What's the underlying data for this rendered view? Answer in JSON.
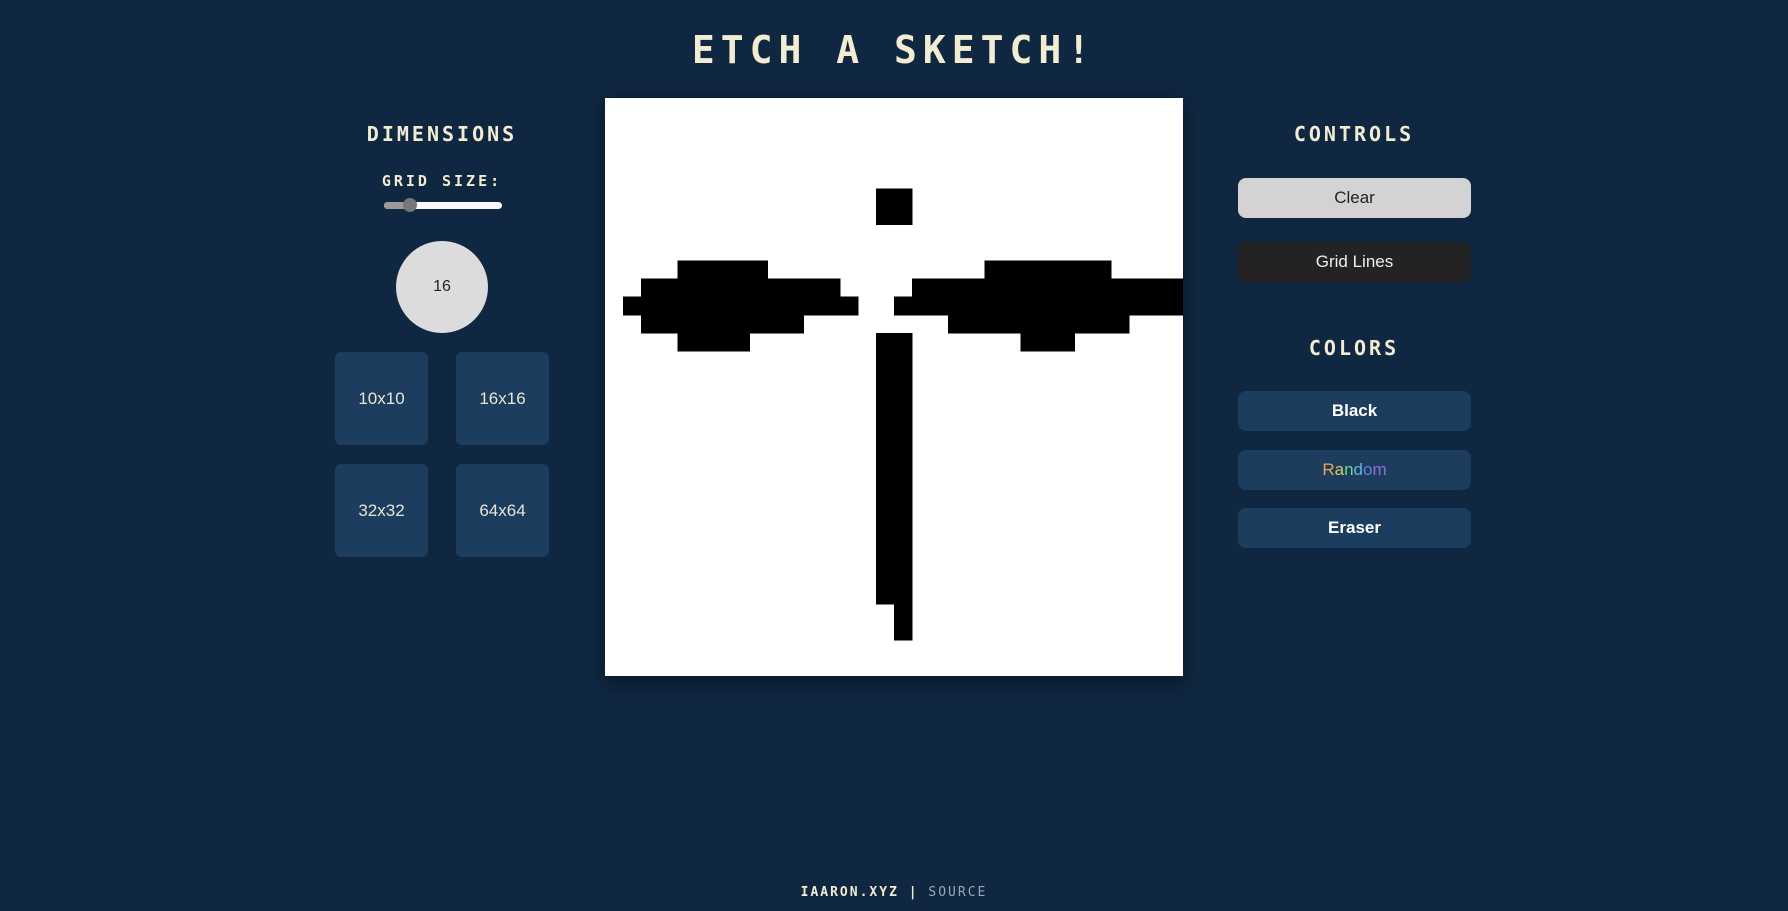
{
  "header": {
    "title": "ETCH A SKETCH!"
  },
  "dimensions": {
    "title": "DIMENSIONS",
    "grid_size_label": "GRID SIZE:",
    "slider": {
      "min": 10,
      "max": 64,
      "value": 16
    },
    "current_size": "16",
    "presets": [
      "10x10",
      "16x16",
      "32x32",
      "64x64"
    ]
  },
  "canvas": {
    "grid_size": 16,
    "rows": [
      "................",
      "................",
      "................",
      "................",
      "................",
      "................",
      "................",
      "................",
      "................",
      "................",
      "................",
      "................",
      "................",
      "................",
      "................",
      "................"
    ]
  },
  "controls": {
    "title": "CONTROLS",
    "clear_label": "Clear",
    "grid_lines_label": "Grid Lines"
  },
  "colors": {
    "title": "COLORS",
    "black_label": "Black",
    "random_label": "Random",
    "random_letter_colors": [
      "#e8a65a",
      "#d9c86a",
      "#7fcf8c",
      "#5fb7d9",
      "#6d7ed9",
      "#8f6fd9"
    ],
    "eraser_label": "Eraser"
  },
  "footer": {
    "site": "IAARON.XYZ",
    "separator": "|",
    "source": "SOURCE"
  },
  "theme": {
    "background": "#0f2740",
    "panel": "#1d3d5e",
    "ink": "#000000",
    "heading": "#f2ecd3"
  }
}
